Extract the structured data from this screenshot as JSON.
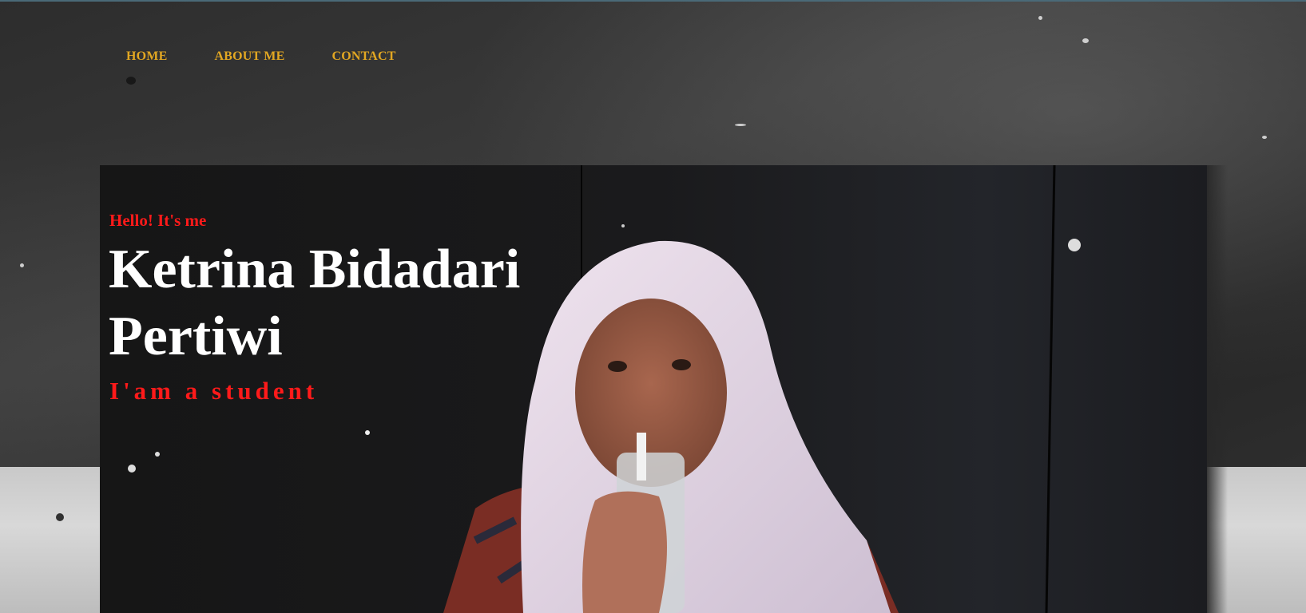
{
  "nav": {
    "items": [
      {
        "label": "HOME"
      },
      {
        "label": "ABOUT ME"
      },
      {
        "label": "CONTACT"
      }
    ],
    "link_color": "#e2a722"
  },
  "hero": {
    "greeting": "Hello! It's me",
    "name": "Ketrina Bidadari Pertiwi",
    "role": "I'am a student",
    "accent_color": "#ff1a1a",
    "photo_icon": "portrait-photo"
  }
}
